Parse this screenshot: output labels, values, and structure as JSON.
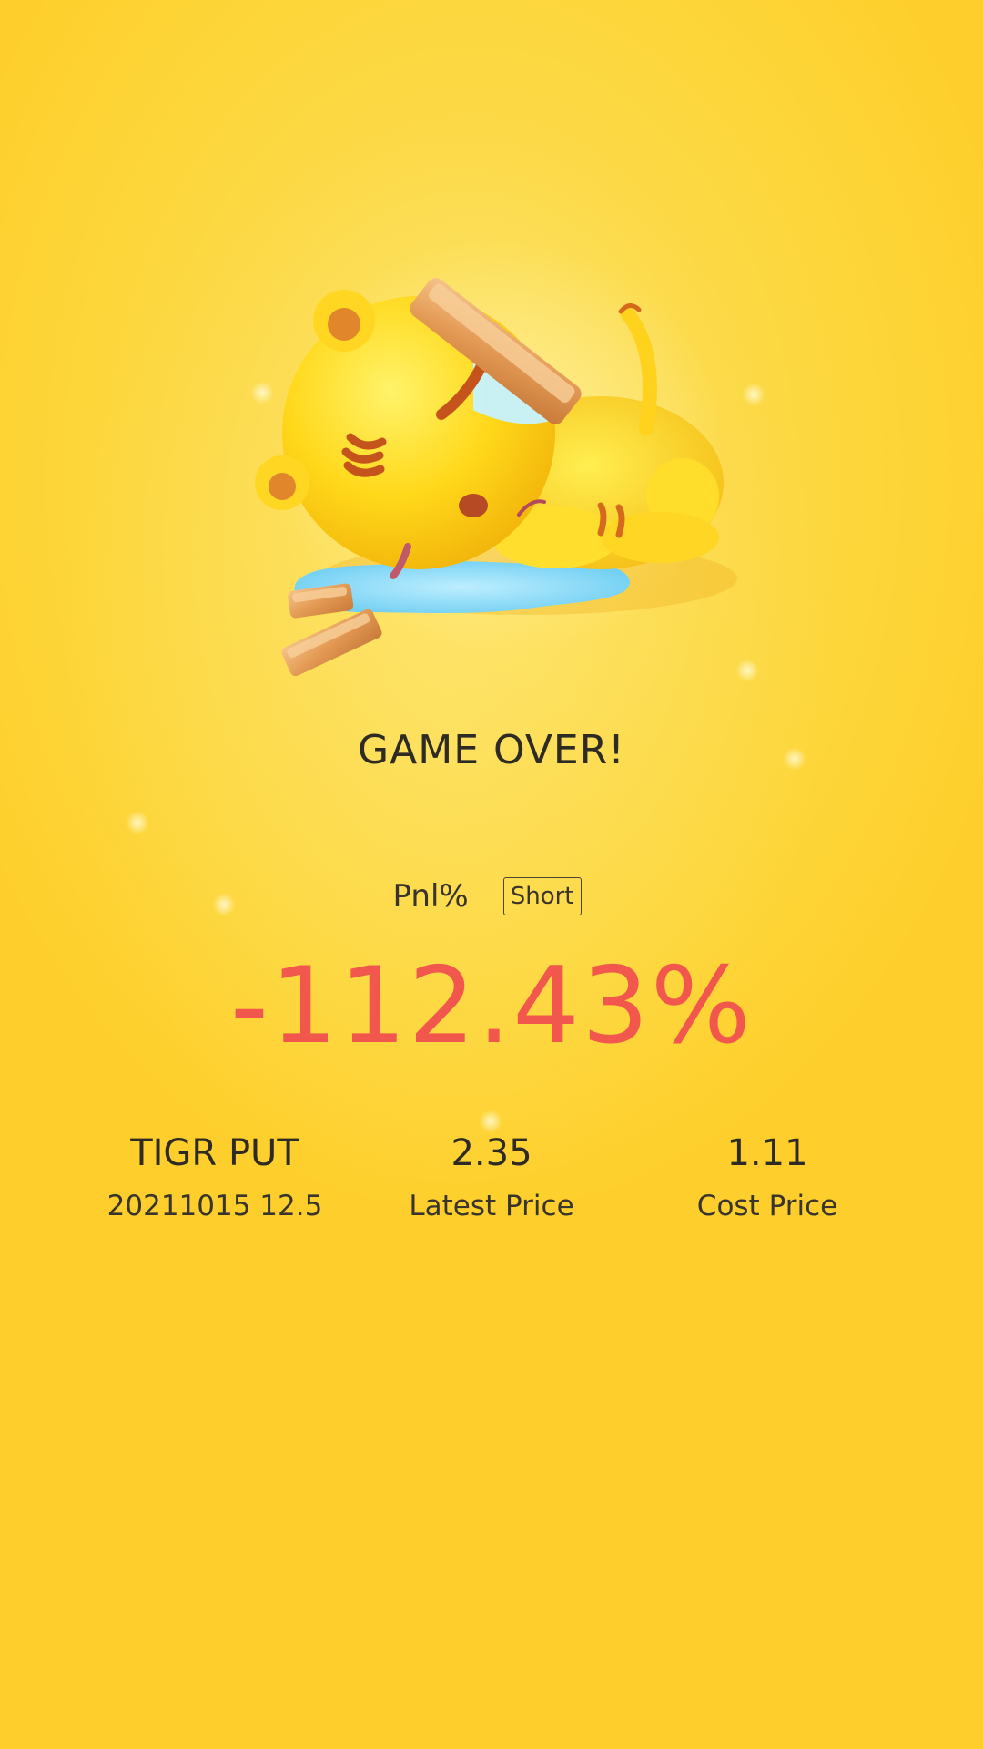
{
  "screen": {
    "title": "GAME OVER!"
  },
  "pnl": {
    "label": "Pnl%",
    "side": "Short",
    "value": "-112.43%"
  },
  "stats": [
    {
      "value": "TIGR PUT",
      "label": "20211015 12.5"
    },
    {
      "value": "2.35",
      "label": "Latest Price"
    },
    {
      "value": "1.11",
      "label": "Cost Price"
    }
  ],
  "colors": {
    "background": "#fdd63a",
    "loss": "#f2574d",
    "text": "#2e2a24"
  },
  "illustration": {
    "icon": "sad-tiger-mascot-icon"
  }
}
